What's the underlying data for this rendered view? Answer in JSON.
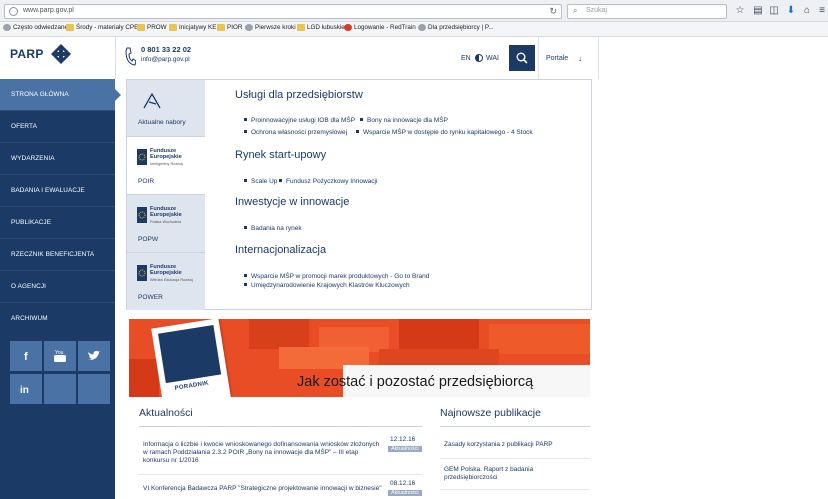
{
  "browser": {
    "url": "www.parp.gov.pl",
    "search_placeholder": "Szukaj",
    "bookmarks": [
      "Często odwiedzane",
      "Środy - materiały CPE",
      "PROW",
      "Inicjatywy KE",
      "PIOR",
      "Pierwsze kroki",
      "LGD lubuskie",
      "Logowanie - RedTrain",
      "Dla przedsiębiorcy | P..."
    ]
  },
  "header": {
    "logo": "PARP",
    "phone": "0 801 33 22 02",
    "email": "info@parp.gov.pl",
    "lang": "EN",
    "wai": "WAI",
    "portale": "Portale"
  },
  "sidebar": {
    "items": [
      {
        "label": "STRONA GŁÓWNA",
        "active": true
      },
      {
        "label": "OFERTA"
      },
      {
        "label": "WYDARZENIA"
      },
      {
        "label": "BADANIA I EWALUACJE"
      },
      {
        "label": "PUBLIKACJE"
      },
      {
        "label": "RZECZNIK BENEFICJENTA"
      },
      {
        "label": "O AGENCJI"
      },
      {
        "label": "ARCHIWUM"
      }
    ],
    "social": [
      "facebook-icon",
      "youtube-icon",
      "twitter-icon",
      "linkedin-icon"
    ]
  },
  "tabs": [
    {
      "label": "Aktualne nabory",
      "active": false
    },
    {
      "label": "POIR",
      "active": true,
      "logo_title": "Fundusze Europejskie",
      "logo_sub": "Inteligentny Rozwój"
    },
    {
      "label": "POPW",
      "active": false,
      "logo_title": "Fundusze Europejskie",
      "logo_sub": "Polska Wschodnia"
    },
    {
      "label": "POWER",
      "active": false,
      "logo_title": "Fundusze Europejskie",
      "logo_sub": "Wiedza Edukacja Rozwój"
    }
  ],
  "sections": [
    {
      "title": "Usługi dla przedsiębiorstw",
      "links": [
        "Proinnowacyjne usługi IOB dla MŚP",
        "Bony na innowacje dla MŚP",
        "Ochrona własności przemysłowej",
        "Wsparcie MŚP w dostępie do rynku kapitałowego - 4 Stock"
      ]
    },
    {
      "title": "Rynek start-upowy",
      "links": [
        "Scale Up",
        "Fundusz Pożyczkowy Innowacji"
      ]
    },
    {
      "title": "Inwestycje w innowacje",
      "links": [
        "Badania na rynek"
      ]
    },
    {
      "title": "Internacjonalizacja",
      "links": [
        "Wsparcie MŚP w promocji marek produktowych - Go to Brand",
        "Umiędzynarodowienie Krajowych Klastrów Kluczowych"
      ]
    }
  ],
  "banner": {
    "text": "Jak zostać i pozostać przedsiębiorcą",
    "booklet_label": "PORADNIK"
  },
  "news": {
    "title": "Aktualności",
    "items": [
      {
        "text": "Informacja o liczbie i kwocie wnioskowanego dofinansowania wniosków złożonych w ramach Poddziałania 2.3.2 POIR „Bony na innowacje dla MŚP” – III etap konkursu nr 1/2016",
        "date": "12.12.16",
        "badge": "Aktualności"
      },
      {
        "text": "VI Konferencja Badawcza PARP \"Strategiczne projektowanie innowacji w biznesie\"",
        "date": "08.12.16",
        "badge": "Aktualności"
      }
    ]
  },
  "publications": {
    "title": "Najnowsze publikacje",
    "items": [
      "Zasady korzystania z publikacji PARP",
      "GEM Polska. Raport z badania przedsiębiorczości"
    ]
  },
  "colors": {
    "navy": "#1b3a66",
    "accent": "#4a72a5",
    "banner_orange": "#e94d25"
  }
}
